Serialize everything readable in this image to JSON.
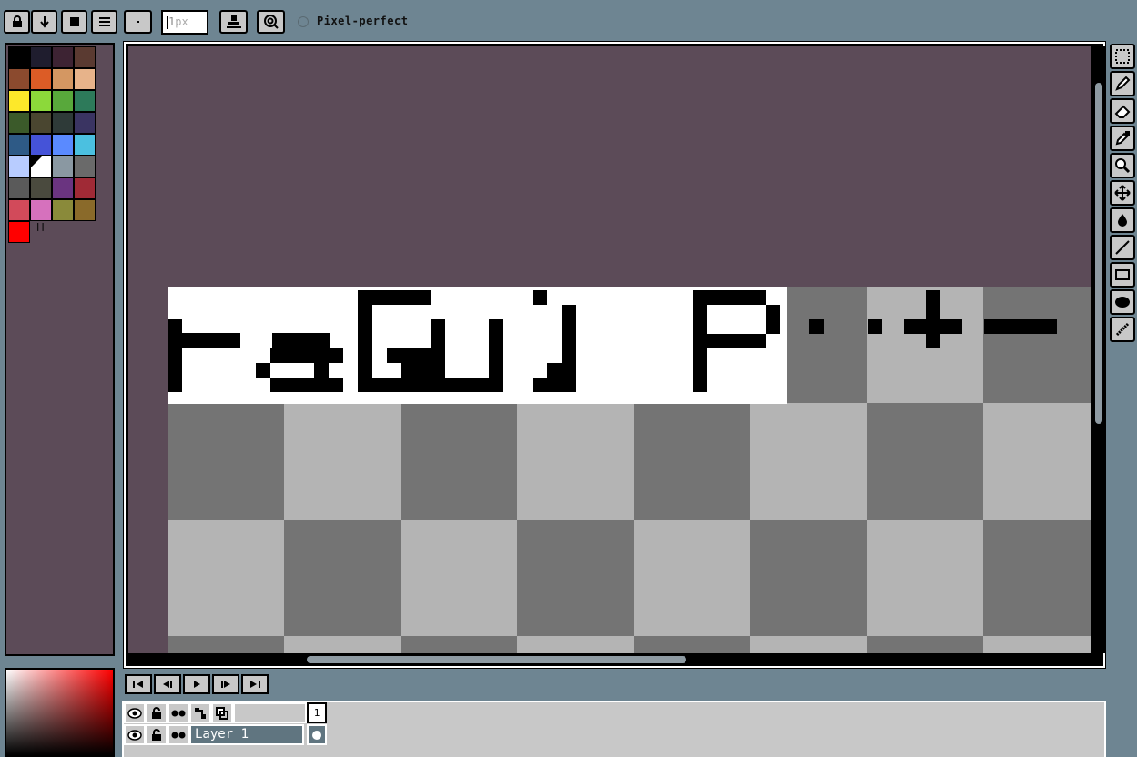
{
  "toolbar": {
    "brush_size_value": "1",
    "brush_size_unit": "px",
    "pixel_perfect_label": "Pixel-perfect",
    "pixel_perfect_checked": false,
    "buttons": [
      "lock-icon",
      "arrow-down-icon",
      "stop-icon",
      "menu-icon",
      "dot-icon",
      "stamp-icon",
      "sketch-icon"
    ]
  },
  "palette": {
    "colors": [
      [
        "#000000",
        "#1f1d2e",
        "#3d2333",
        "#5a3a31"
      ],
      [
        "#8b4a2e",
        "#dc5c26",
        "#d49762",
        "#e7b38a"
      ],
      [
        "#fde82a",
        "#8cd93a",
        "#58a83b",
        "#2d7a5a"
      ],
      [
        "#3b5a2a",
        "#4a4630",
        "#2e3a38",
        "#3a3462"
      ],
      [
        "#2e5a86",
        "#4553d8",
        "#5a8aff",
        "#4bc0e0"
      ],
      [
        "#b8ccff",
        "#ffffff",
        "#8a98a2",
        "#6a6a6a"
      ],
      [
        "#5a5a5a",
        "#4a4a3e",
        "#6a3480",
        "#a02a36"
      ],
      [
        "#d24a5a",
        "#d671bd",
        "#8a8a3a",
        "#8a6a2a"
      ]
    ],
    "selected_color": "#ff0000",
    "selected_marker": "||"
  },
  "canvas": {
    "background_color": "#5c4b58",
    "checker_light": "#b4b4b4",
    "checker_dark": "#747474",
    "content_color": "#000000"
  },
  "tools": [
    "selection-icon",
    "pencil-icon",
    "eraser-icon",
    "eyedropper-icon",
    "zoom-icon",
    "move-icon",
    "fill-icon",
    "line-icon",
    "rectangle-icon",
    "ellipse-icon",
    "spray-icon"
  ],
  "playback": [
    "first-frame-icon",
    "prev-frame-icon",
    "play-icon",
    "next-frame-icon",
    "last-frame-icon"
  ],
  "layers": {
    "header_icons": [
      "eye-icon",
      "lock-icon",
      "onion-icon",
      "link-icon",
      "layer-copy-icon"
    ],
    "frame_number": "1",
    "rows": [
      {
        "name": "Layer 1"
      }
    ]
  }
}
